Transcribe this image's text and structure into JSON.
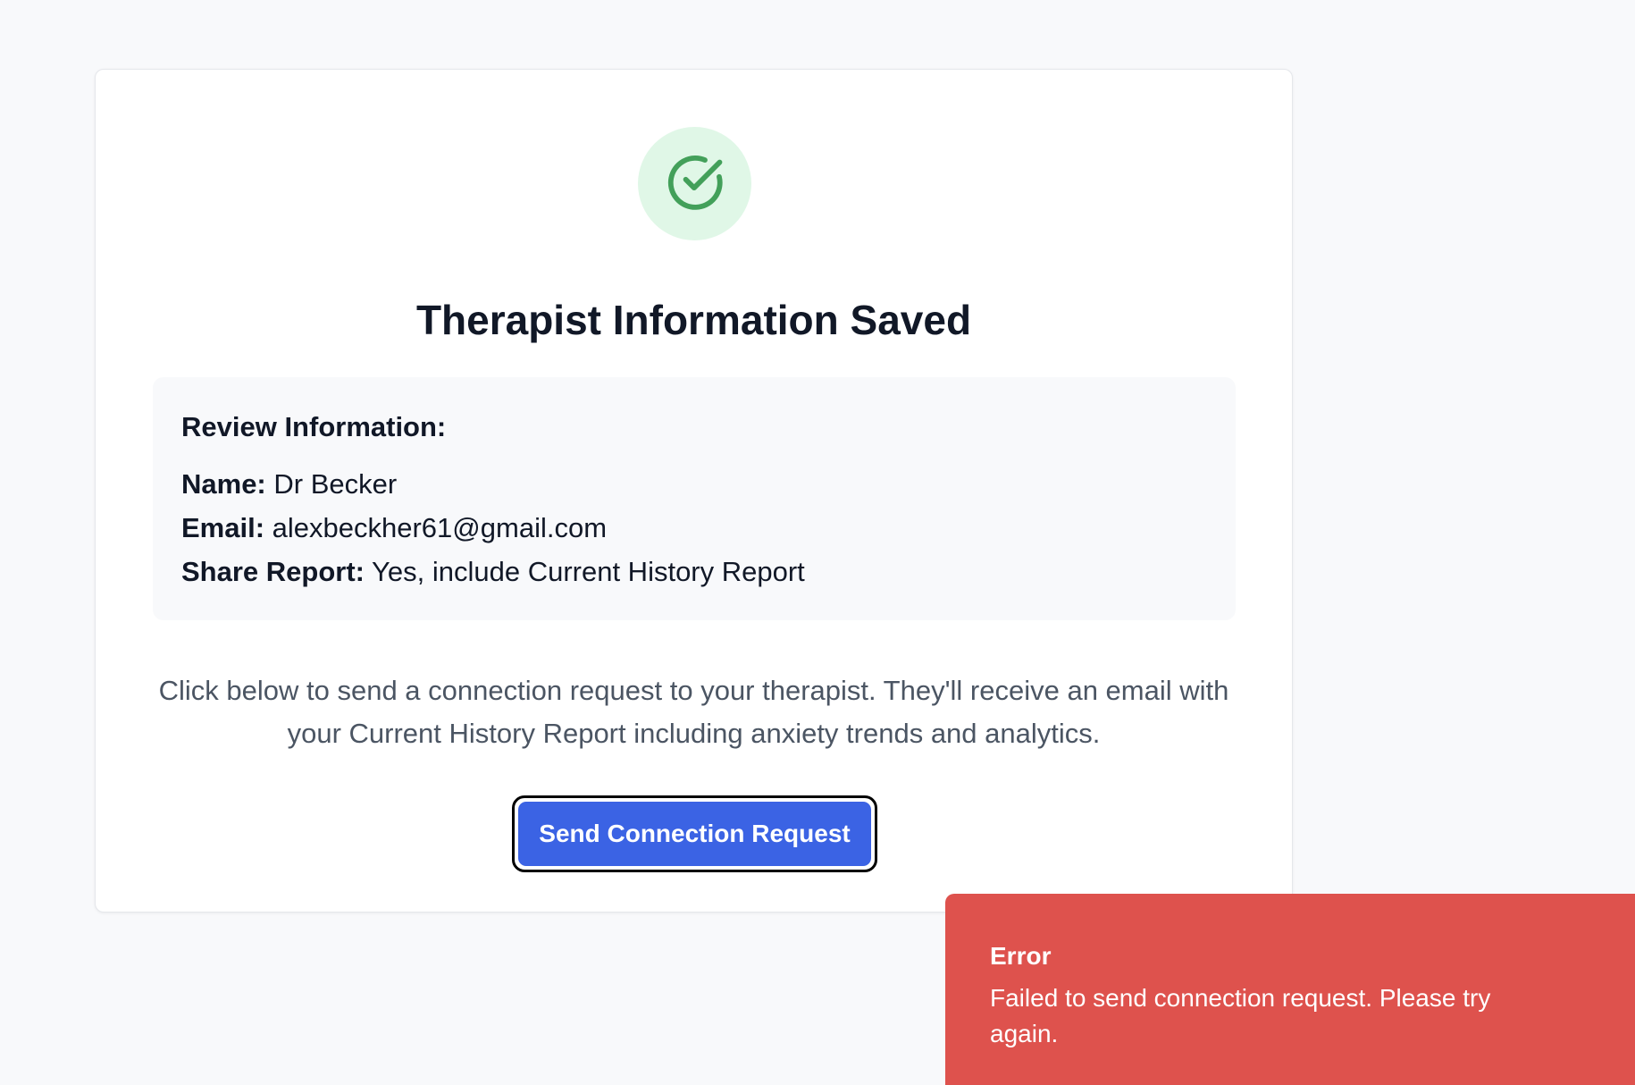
{
  "card": {
    "title": "Therapist Information Saved",
    "status_icon": "check-circle-icon"
  },
  "review": {
    "heading": "Review Information:",
    "name_label": "Name:",
    "name_value": "Dr Becker",
    "email_label": "Email:",
    "email_value": "alexbeckher61@gmail.com",
    "share_label": "Share Report:",
    "share_value": "Yes, include Current History Report"
  },
  "instructions": "Click below to send a connection request to your therapist. They'll receive an email with your Current History Report including anxiety trends and analytics.",
  "actions": {
    "send_label": "Send Connection Request"
  },
  "toast": {
    "title": "Error",
    "message": "Failed to send connection request. Please try again."
  },
  "colors": {
    "page_bg": "#f8f9fb",
    "success_bg": "#e0f7e7",
    "success_icon": "#43a05a",
    "primary": "#3b63e4",
    "error": "#de524d",
    "muted_text": "#4b5563"
  }
}
